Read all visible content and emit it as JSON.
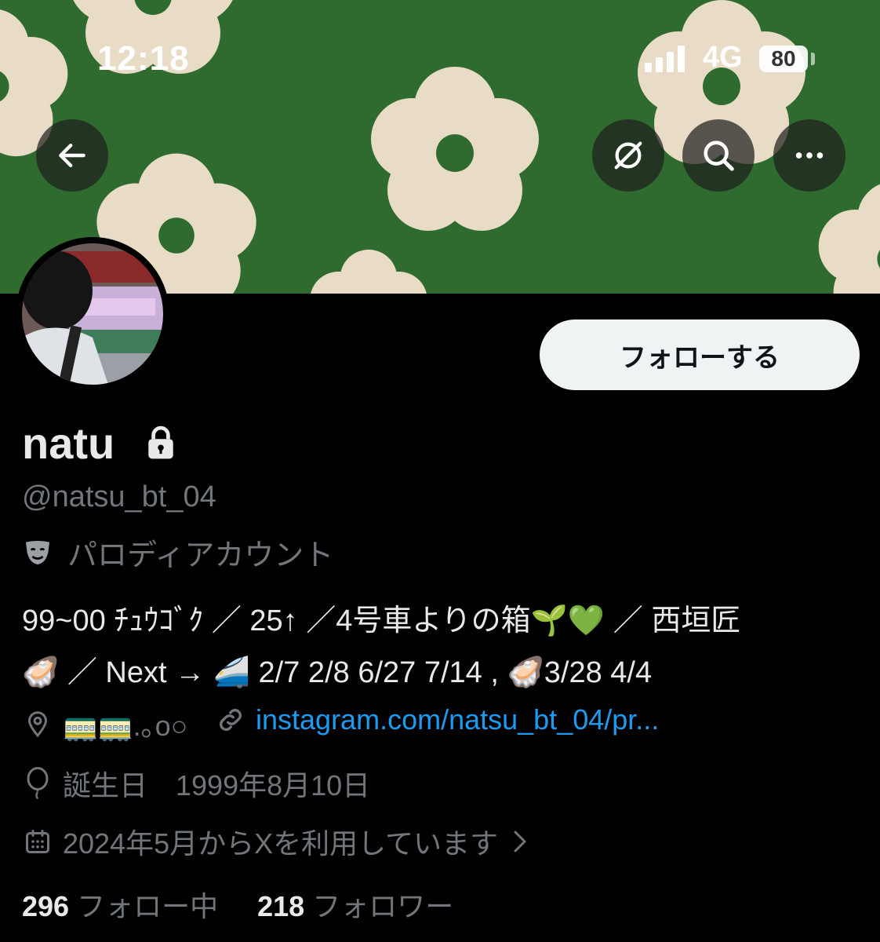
{
  "status_bar": {
    "time": "12:18",
    "network": "4G",
    "battery": "80"
  },
  "header": {
    "back_icon": "arrow-left-icon",
    "grok_icon": "slash-circle-icon",
    "search_icon": "search-icon",
    "more_icon": "more-icon"
  },
  "banner": {
    "background": "#2f6b2e",
    "flower_color": "#e8dcc6"
  },
  "profile": {
    "display_name": "natu",
    "handle": "@natsu_bt_04",
    "parody_label": "パロディアカウント",
    "follow_button": "フォローする",
    "bio_line1": "99~00 ﾁｭｳｺﾞｸ ／ 25↑ ／4号車よりの箱🌱💚 ／ 西垣匠",
    "bio_line2": "🦪 ／ Next → 🚄 2/7 2/8 6/27 7/14 , 🦪3/28 4/4",
    "location": "🚃🚃.｡o○",
    "website": "instagram.com/natsu_bt_04/pr...",
    "birthday": "誕生日　1999年8月10日",
    "joined": "2024年5月からXを利用しています",
    "following_count": "296",
    "following_label": "フォロー中",
    "followers_count": "218",
    "followers_label": "フォロワー"
  },
  "colors": {
    "accent": "#1d9bf0",
    "muted": "#71767b",
    "text": "#e7e9ea"
  }
}
